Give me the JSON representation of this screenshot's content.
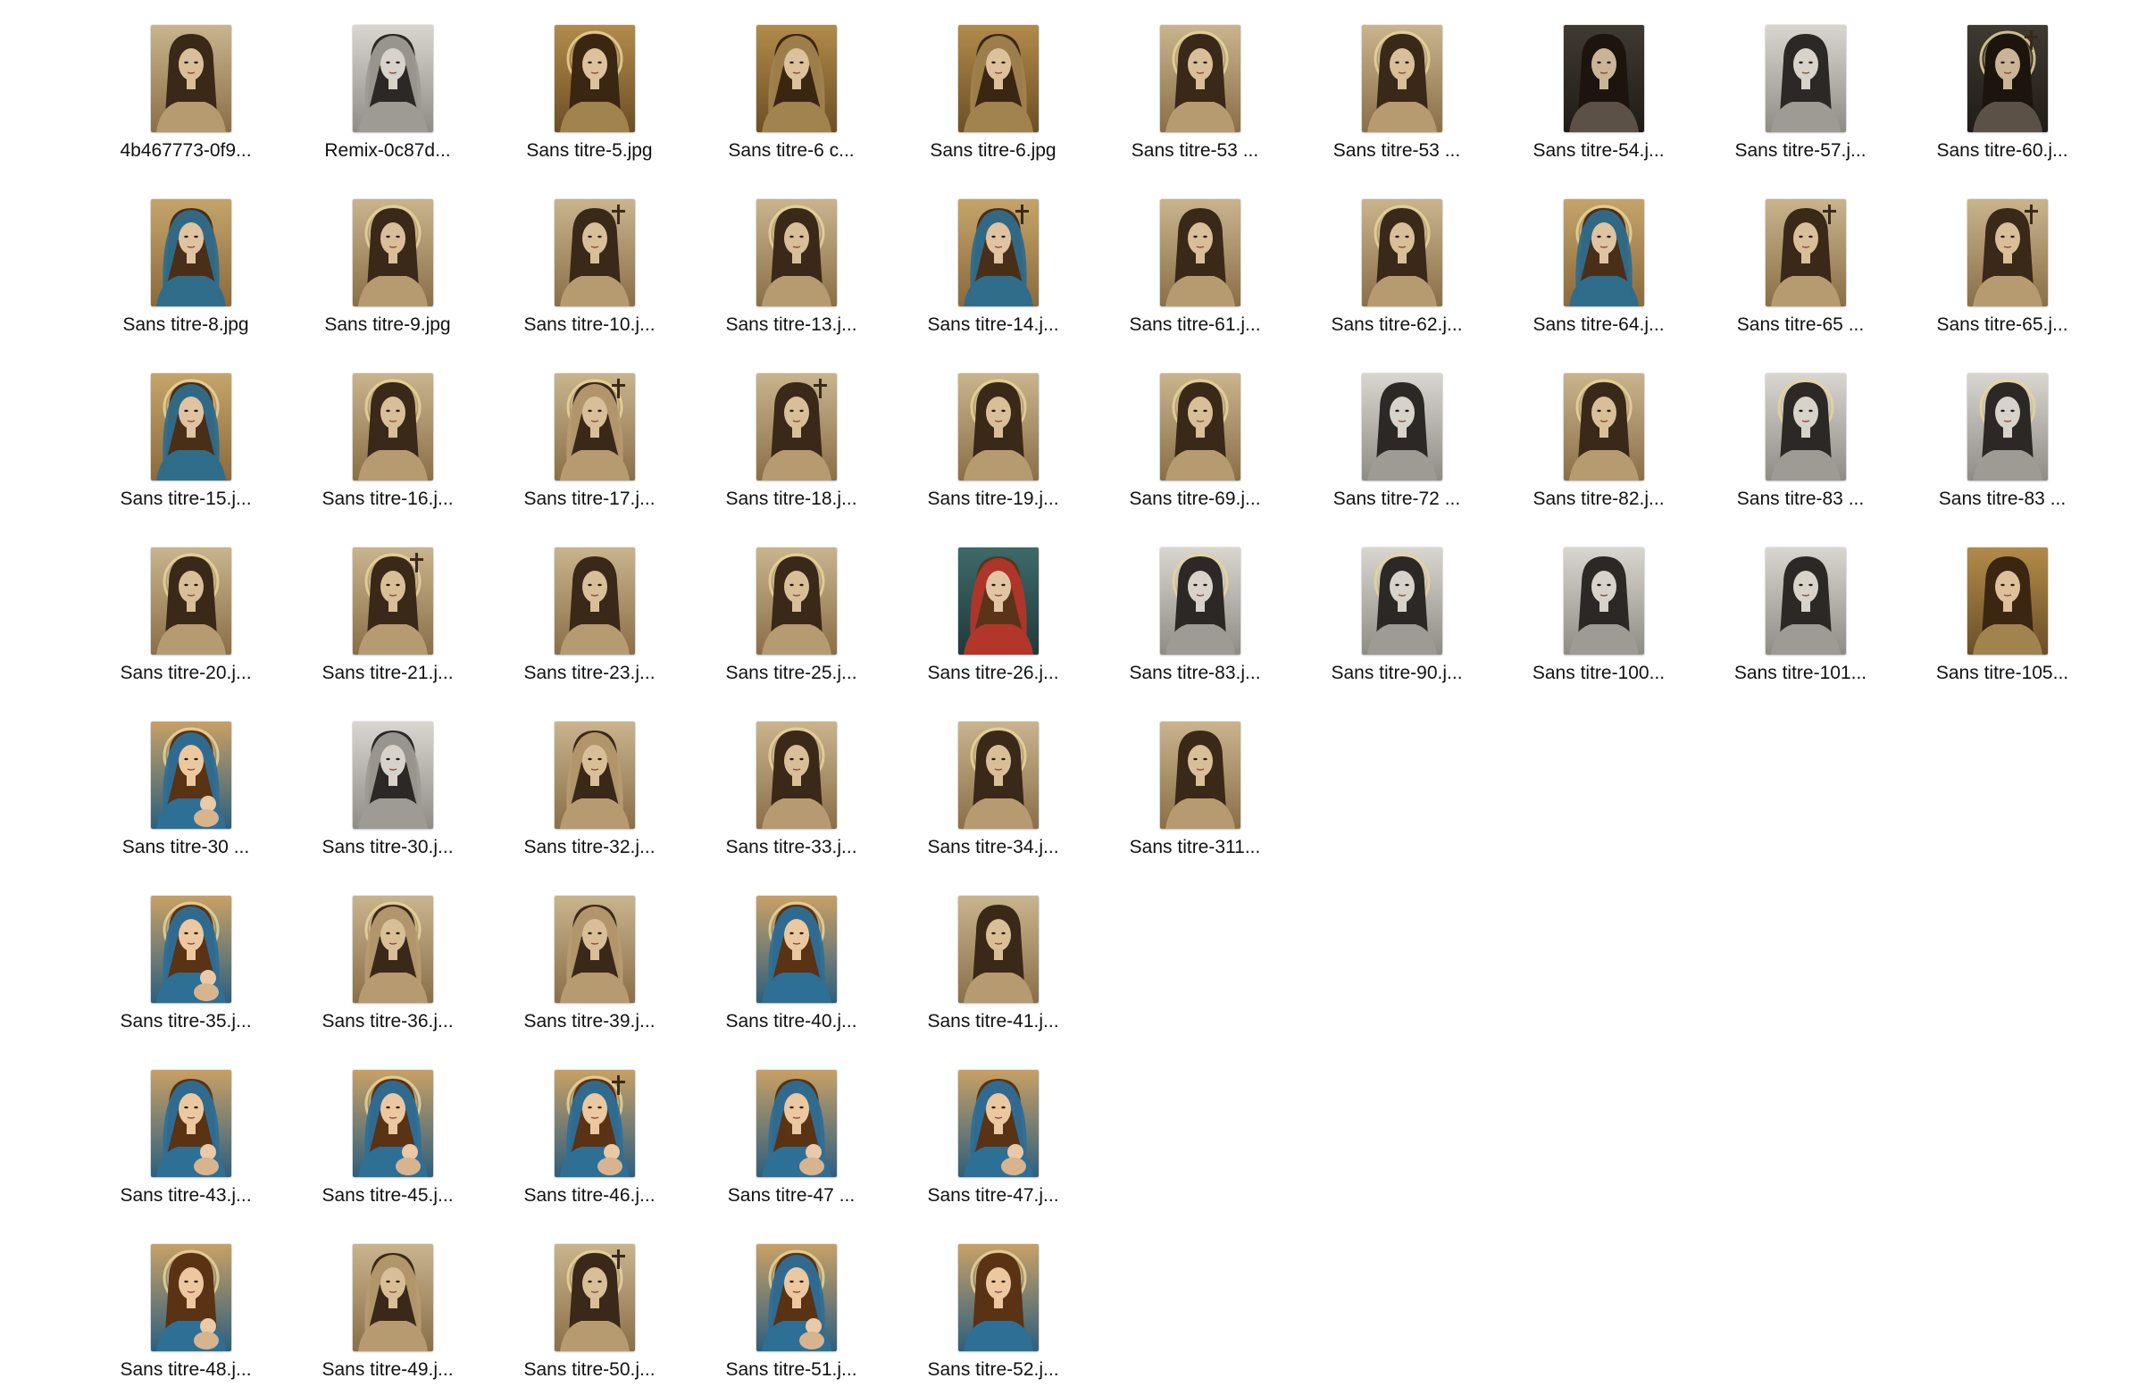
{
  "window": {
    "view": "icon-grid",
    "background": "#ffffff"
  },
  "palette": {
    "sepia": {
      "bg": "#c9b48d",
      "bg2": "#8a6f48",
      "hair": "#3a2818",
      "skin": "#d9bf98",
      "robe": "#b79b70"
    },
    "dark": {
      "bg": "#3f3a32",
      "bg2": "#1f1b16",
      "hair": "#1c140d",
      "skin": "#c9b596",
      "robe": "#5b5147"
    },
    "gold": {
      "bg": "#b28b4a",
      "bg2": "#6d4f26",
      "hair": "#3b2612",
      "skin": "#dcc19a",
      "robe": "#a1834e"
    },
    "blue": {
      "bg": "#c5a46a",
      "bg2": "#8b6a3c",
      "hair": "#4a2f18",
      "skin": "#e0c3a0",
      "robe": "#2f6d8a"
    },
    "red": {
      "bg": "#3e6a6a",
      "bg2": "#1f3a3a",
      "hair": "#5a3418",
      "skin": "#e2c6a4",
      "robe": "#b2362a"
    },
    "bw": {
      "bg": "#d9d6d0",
      "bg2": "#8f8c86",
      "hair": "#2b2825",
      "skin": "#d7d2ca",
      "robe": "#9e9a94"
    },
    "color": {
      "bg": "#c8a064",
      "bg2": "#2d5f7e",
      "hair": "#5a3214",
      "skin": "#ecc8a0",
      "robe": "#2e6f96"
    }
  },
  "files": [
    {
      "name": "4b467773-0f9...",
      "style": "sepia",
      "veil": false,
      "halo": false,
      "cross": false,
      "baby": false
    },
    {
      "name": "Remix-0c87d...",
      "style": "bw",
      "veil": true,
      "halo": false,
      "cross": false,
      "baby": false
    },
    {
      "name": "Sans titre-5.jpg",
      "style": "gold",
      "veil": false,
      "halo": true,
      "cross": false,
      "baby": false
    },
    {
      "name": "Sans titre-6 c...",
      "style": "gold",
      "veil": true,
      "halo": false,
      "cross": false,
      "baby": false
    },
    {
      "name": "Sans titre-6.jpg",
      "style": "gold",
      "veil": true,
      "halo": false,
      "cross": false,
      "baby": false
    },
    {
      "name": "Sans titre-53 ...",
      "style": "sepia",
      "veil": false,
      "halo": true,
      "cross": false,
      "baby": false
    },
    {
      "name": "Sans titre-53 ...",
      "style": "sepia",
      "veil": false,
      "halo": true,
      "cross": false,
      "baby": false
    },
    {
      "name": "Sans titre-54.j...",
      "style": "dark",
      "veil": false,
      "halo": false,
      "cross": false,
      "baby": false
    },
    {
      "name": "Sans titre-57.j...",
      "style": "bw",
      "veil": false,
      "halo": false,
      "cross": false,
      "baby": false
    },
    {
      "name": "Sans titre-60.j...",
      "style": "dark",
      "veil": false,
      "halo": true,
      "cross": true,
      "baby": false
    },
    {
      "name": "Sans titre-8.jpg",
      "style": "blue",
      "veil": true,
      "halo": false,
      "cross": false,
      "baby": false
    },
    {
      "name": "Sans titre-9.jpg",
      "style": "sepia",
      "veil": false,
      "halo": true,
      "cross": false,
      "baby": false
    },
    {
      "name": "Sans titre-10.j...",
      "style": "sepia",
      "veil": false,
      "halo": false,
      "cross": true,
      "baby": false
    },
    {
      "name": "Sans titre-13.j...",
      "style": "sepia",
      "veil": false,
      "halo": true,
      "cross": false,
      "baby": false
    },
    {
      "name": "Sans titre-14.j...",
      "style": "blue",
      "veil": true,
      "halo": false,
      "cross": true,
      "baby": false
    },
    {
      "name": "Sans titre-61.j...",
      "style": "sepia",
      "veil": false,
      "halo": false,
      "cross": false,
      "baby": false
    },
    {
      "name": "Sans titre-62.j...",
      "style": "sepia",
      "veil": false,
      "halo": true,
      "cross": false,
      "baby": false
    },
    {
      "name": "Sans titre-64.j...",
      "style": "blue",
      "veil": true,
      "halo": true,
      "cross": false,
      "baby": false
    },
    {
      "name": "Sans titre-65 ...",
      "style": "sepia",
      "veil": false,
      "halo": false,
      "cross": true,
      "baby": false
    },
    {
      "name": "Sans titre-65.j...",
      "style": "sepia",
      "veil": false,
      "halo": false,
      "cross": true,
      "baby": false
    },
    {
      "name": "Sans titre-15.j...",
      "style": "blue",
      "veil": true,
      "halo": true,
      "cross": false,
      "baby": false
    },
    {
      "name": "Sans titre-16.j...",
      "style": "sepia",
      "veil": false,
      "halo": true,
      "cross": false,
      "baby": false
    },
    {
      "name": "Sans titre-17.j...",
      "style": "sepia",
      "veil": true,
      "halo": true,
      "cross": true,
      "baby": false
    },
    {
      "name": "Sans titre-18.j...",
      "style": "sepia",
      "veil": false,
      "halo": false,
      "cross": true,
      "baby": false
    },
    {
      "name": "Sans titre-19.j...",
      "style": "sepia",
      "veil": false,
      "halo": true,
      "cross": false,
      "baby": false
    },
    {
      "name": "Sans titre-69.j...",
      "style": "sepia",
      "veil": false,
      "halo": true,
      "cross": false,
      "baby": false
    },
    {
      "name": "Sans titre-72 ...",
      "style": "bw",
      "veil": false,
      "halo": false,
      "cross": false,
      "baby": false
    },
    {
      "name": "Sans titre-82.j...",
      "style": "sepia",
      "veil": false,
      "halo": true,
      "cross": false,
      "baby": false
    },
    {
      "name": "Sans titre-83 ...",
      "style": "bw",
      "veil": false,
      "halo": true,
      "cross": false,
      "baby": false
    },
    {
      "name": "Sans titre-83 ...",
      "style": "bw",
      "veil": false,
      "halo": true,
      "cross": false,
      "baby": false
    },
    {
      "name": "Sans titre-20.j...",
      "style": "sepia",
      "veil": false,
      "halo": true,
      "cross": false,
      "baby": false
    },
    {
      "name": "Sans titre-21.j...",
      "style": "sepia",
      "veil": false,
      "halo": true,
      "cross": true,
      "baby": false
    },
    {
      "name": "Sans titre-23.j...",
      "style": "sepia",
      "veil": false,
      "halo": false,
      "cross": false,
      "baby": false
    },
    {
      "name": "Sans titre-25.j...",
      "style": "sepia",
      "veil": false,
      "halo": true,
      "cross": false,
      "baby": false
    },
    {
      "name": "Sans titre-26.j...",
      "style": "red",
      "veil": true,
      "halo": false,
      "cross": false,
      "baby": false
    },
    {
      "name": "Sans titre-83.j...",
      "style": "bw",
      "veil": false,
      "halo": true,
      "cross": false,
      "baby": false
    },
    {
      "name": "Sans titre-90.j...",
      "style": "bw",
      "veil": false,
      "halo": true,
      "cross": false,
      "baby": false
    },
    {
      "name": "Sans titre-100...",
      "style": "bw",
      "veil": false,
      "halo": false,
      "cross": false,
      "baby": false
    },
    {
      "name": "Sans titre-101...",
      "style": "bw",
      "veil": false,
      "halo": false,
      "cross": false,
      "baby": false
    },
    {
      "name": "Sans titre-105...",
      "style": "gold",
      "veil": false,
      "halo": false,
      "cross": false,
      "baby": false
    },
    {
      "name": "Sans titre-30 ...",
      "style": "color",
      "veil": true,
      "halo": true,
      "cross": false,
      "baby": true
    },
    {
      "name": "Sans titre-30.j...",
      "style": "bw",
      "veil": true,
      "halo": false,
      "cross": false,
      "baby": false
    },
    {
      "name": "Sans titre-32.j...",
      "style": "sepia",
      "veil": true,
      "halo": false,
      "cross": false,
      "baby": false
    },
    {
      "name": "Sans titre-33.j...",
      "style": "sepia",
      "veil": false,
      "halo": true,
      "cross": false,
      "baby": false
    },
    {
      "name": "Sans titre-34.j...",
      "style": "sepia",
      "veil": false,
      "halo": true,
      "cross": false,
      "baby": false
    },
    {
      "name": "Sans titre-311...",
      "style": "sepia",
      "veil": false,
      "halo": false,
      "cross": false,
      "baby": false
    },
    {
      "name": "Sans titre-35.j...",
      "style": "color",
      "veil": true,
      "halo": true,
      "cross": false,
      "baby": true
    },
    {
      "name": "Sans titre-36.j...",
      "style": "sepia",
      "veil": true,
      "halo": true,
      "cross": false,
      "baby": false
    },
    {
      "name": "Sans titre-39.j...",
      "style": "sepia",
      "veil": true,
      "halo": false,
      "cross": false,
      "baby": false
    },
    {
      "name": "Sans titre-40.j...",
      "style": "color",
      "veil": true,
      "halo": true,
      "cross": false,
      "baby": false
    },
    {
      "name": "Sans titre-41.j...",
      "style": "sepia",
      "veil": false,
      "halo": false,
      "cross": false,
      "baby": false
    },
    {
      "name": "Sans titre-43.j...",
      "style": "color",
      "veil": true,
      "halo": false,
      "cross": false,
      "baby": true
    },
    {
      "name": "Sans titre-45.j...",
      "style": "color",
      "veil": true,
      "halo": true,
      "cross": false,
      "baby": true
    },
    {
      "name": "Sans titre-46.j...",
      "style": "color",
      "veil": true,
      "halo": true,
      "cross": true,
      "baby": true
    },
    {
      "name": "Sans titre-47 ...",
      "style": "color",
      "veil": true,
      "halo": false,
      "cross": false,
      "baby": true
    },
    {
      "name": "Sans titre-47.j...",
      "style": "color",
      "veil": true,
      "halo": false,
      "cross": false,
      "baby": true
    },
    {
      "name": "Sans titre-48.j...",
      "style": "color",
      "veil": false,
      "halo": true,
      "cross": false,
      "baby": true
    },
    {
      "name": "Sans titre-49.j...",
      "style": "sepia",
      "veil": true,
      "halo": false,
      "cross": false,
      "baby": false
    },
    {
      "name": "Sans titre-50.j...",
      "style": "sepia",
      "veil": false,
      "halo": true,
      "cross": true,
      "baby": false
    },
    {
      "name": "Sans titre-51.j...",
      "style": "color",
      "veil": true,
      "halo": true,
      "cross": false,
      "baby": true
    },
    {
      "name": "Sans titre-52.j...",
      "style": "color",
      "veil": false,
      "halo": true,
      "cross": false,
      "baby": false
    }
  ],
  "rows": [
    10,
    10,
    10,
    10,
    6,
    5,
    5,
    5
  ]
}
